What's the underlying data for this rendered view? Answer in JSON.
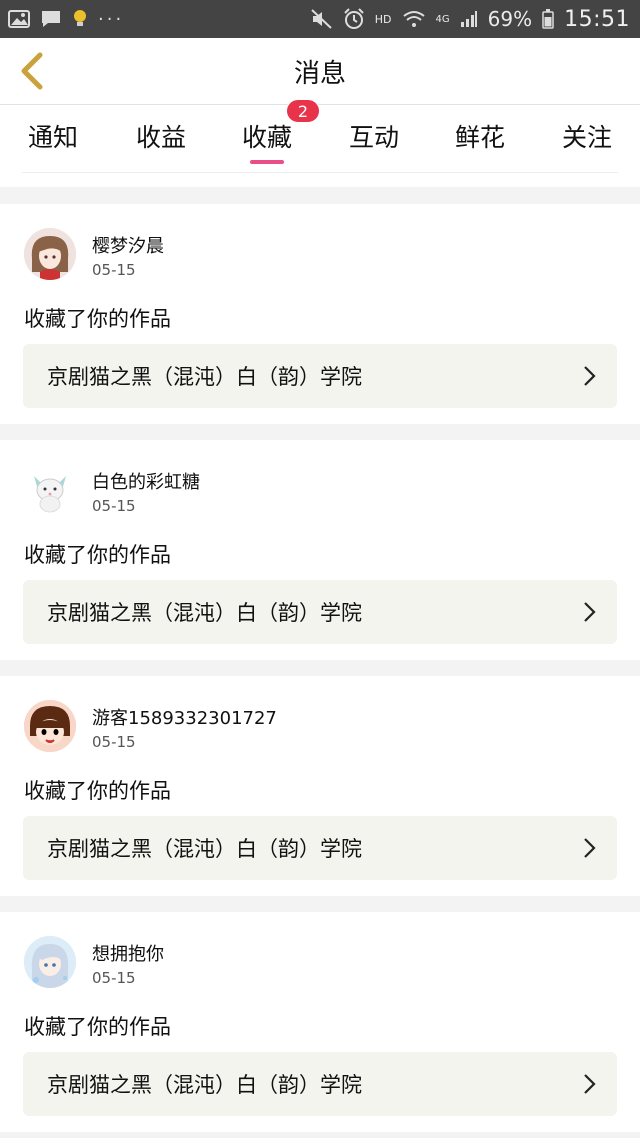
{
  "status_bar": {
    "battery_percent": "69%",
    "time": "15:51",
    "dots": "···",
    "network_label": "HD",
    "signal_label": "4G",
    "left_icons": [
      "gallery-icon",
      "chat-bubble-icon",
      "lightbulb-icon"
    ],
    "right_icons": [
      "mute-icon",
      "alarm-icon",
      "wifi-icon",
      "signal-icon",
      "battery-icon"
    ]
  },
  "header": {
    "title": "消息",
    "back_icon": "chevron-left-icon",
    "accent_color": "#c8a23a"
  },
  "tabs": [
    {
      "label": "通知"
    },
    {
      "label": "收益"
    },
    {
      "label": "收藏",
      "active": true,
      "badge": "2"
    },
    {
      "label": "互动"
    },
    {
      "label": "鲜花"
    },
    {
      "label": "关注"
    }
  ],
  "colors": {
    "tab_underline": "#e94f86",
    "badge": "#e8334b",
    "work_box_bg": "#f4f4ee"
  },
  "items": [
    {
      "username": "樱梦汐晨",
      "date": "05-15",
      "action": "收藏了你的作品",
      "work_title": "京剧猫之黑（混沌）白（韵）学院"
    },
    {
      "username": "白色的彩虹糖",
      "date": "05-15",
      "action": "收藏了你的作品",
      "work_title": "京剧猫之黑（混沌）白（韵）学院"
    },
    {
      "username": "游客1589332301727",
      "date": "05-15",
      "action": "收藏了你的作品",
      "work_title": "京剧猫之黑（混沌）白（韵）学院"
    },
    {
      "username": "想拥抱你",
      "date": "05-15",
      "action": "收藏了你的作品",
      "work_title": "京剧猫之黑（混沌）白（韵）学院"
    }
  ]
}
